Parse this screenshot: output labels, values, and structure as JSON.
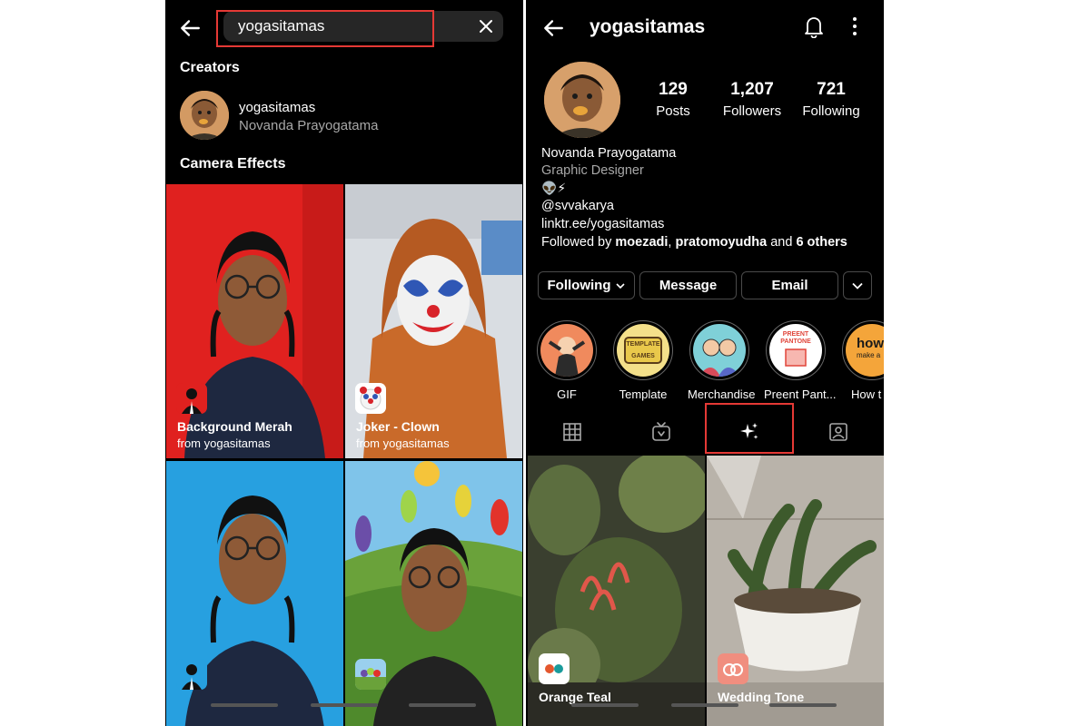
{
  "left": {
    "search": {
      "value": "yogasitamas"
    },
    "creators_title": "Creators",
    "creator": {
      "username": "yogasitamas",
      "fullname": "Novanda Prayogatama"
    },
    "effects_title": "Camera Effects",
    "effects": [
      {
        "name": "Background Merah",
        "from": "from yogasitamas"
      },
      {
        "name": "Joker - Clown",
        "from": "from yogasitamas"
      }
    ]
  },
  "right": {
    "username": "yogasitamas",
    "stats": [
      {
        "num": "129",
        "label": "Posts"
      },
      {
        "num": "1,207",
        "label": "Followers"
      },
      {
        "num": "721",
        "label": "Following"
      }
    ],
    "bio": {
      "name": "Novanda Prayogatama",
      "category": "Graphic Designer",
      "emoji": "👽⚡",
      "handle": "@svvakarya",
      "link": "linktr.ee/yogasitamas",
      "followed_prefix": "Followed by ",
      "followed_user1": "moezadi",
      "followed_sep": ", ",
      "followed_user2": "pratomoyudha",
      "followed_and": " and ",
      "followed_others": "6 others"
    },
    "buttons": {
      "following": "Following",
      "message": "Message",
      "email": "Email"
    },
    "highlights": [
      {
        "label": "GIF"
      },
      {
        "label": "Template"
      },
      {
        "label": "Merchandise"
      },
      {
        "label": "Preent Pant..."
      },
      {
        "label": "How t"
      }
    ],
    "highlight_texts": {
      "template": "TEMPLATE GAMES",
      "preent": "PREENT PANTONE",
      "how": "how",
      "how_sub": "make a"
    },
    "reels": [
      {
        "name": "Orange Teal"
      },
      {
        "name": "Wedding Tone"
      }
    ]
  },
  "colors": {
    "accent_red": "#e53935",
    "bg": "#000000",
    "muted_text": "#a8a8a8"
  }
}
